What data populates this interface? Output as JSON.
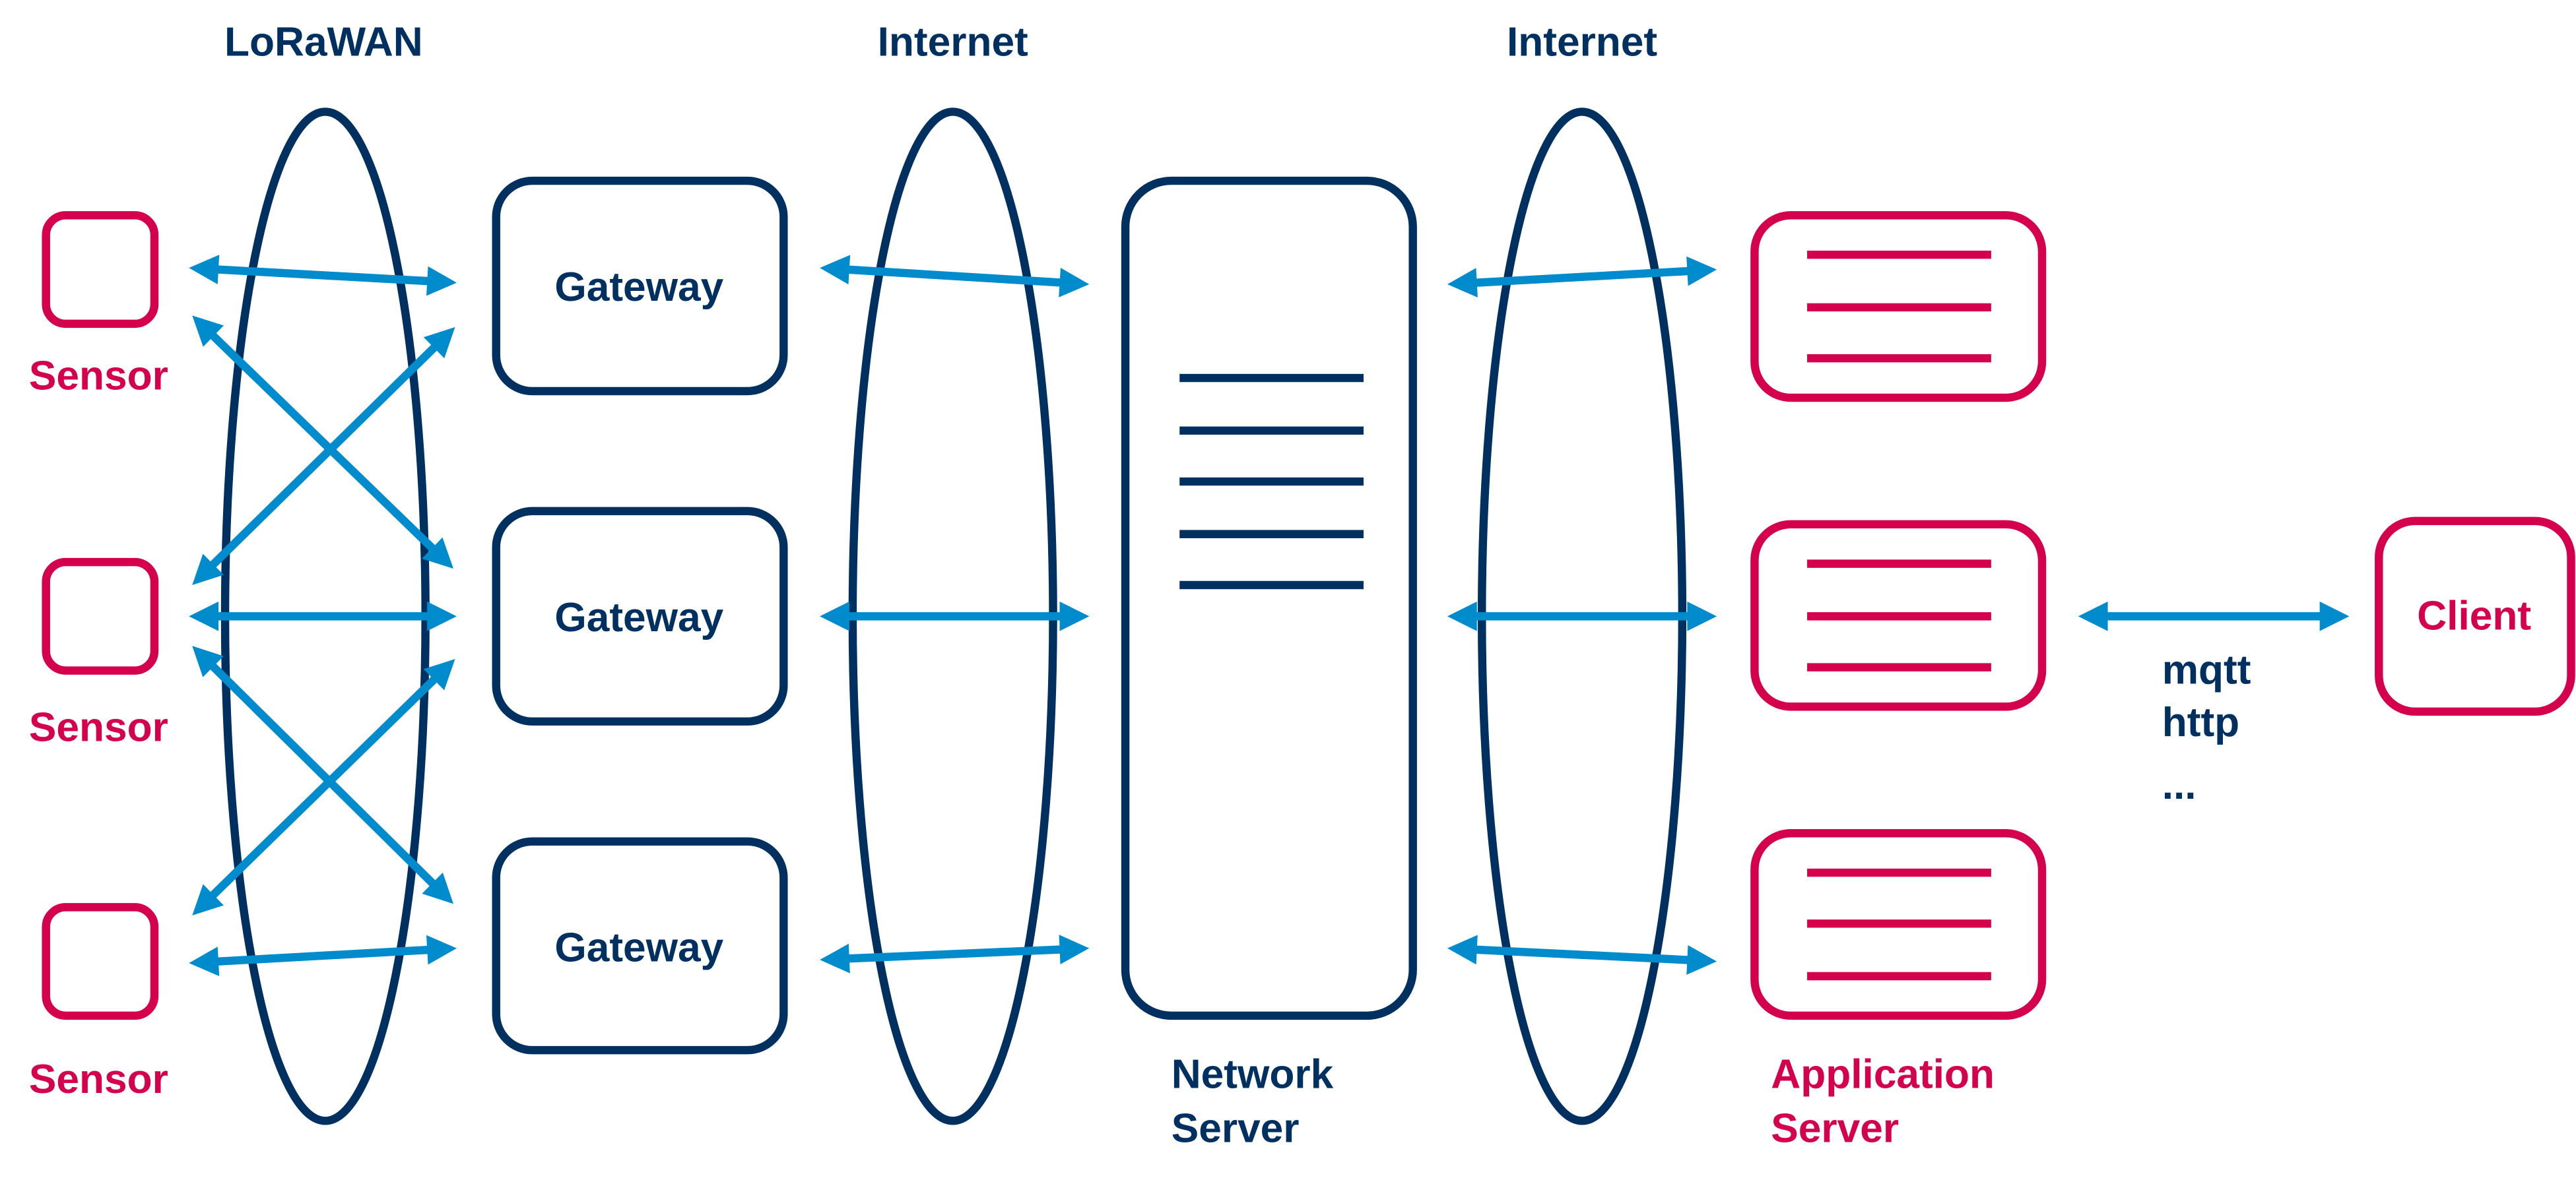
{
  "colors": {
    "navy": "#00305F",
    "crimson": "#D4004B",
    "link_blue": "#008CCC",
    "background": "#FFFFFF"
  },
  "headers": {
    "lorawan": "LoRaWAN",
    "internet_left": "Internet",
    "internet_right": "Internet"
  },
  "sensors": [
    {
      "label": "Sensor"
    },
    {
      "label": "Sensor"
    },
    {
      "label": "Sensor"
    }
  ],
  "gateways": [
    {
      "label": "Gateway"
    },
    {
      "label": "Gateway"
    },
    {
      "label": "Gateway"
    }
  ],
  "network_server": {
    "label_line1": "Network",
    "label_line2": "Server"
  },
  "application_servers": {
    "count": 3,
    "label_line1": "Application",
    "label_line2": "Server"
  },
  "client": {
    "label": "Client"
  },
  "protocols": [
    "mqtt",
    "http",
    "..."
  ],
  "connections": [
    {
      "from": "sensor-1",
      "to": "gateway-1",
      "type": "bidirectional"
    },
    {
      "from": "sensor-1",
      "to": "gateway-2",
      "type": "bidirectional"
    },
    {
      "from": "sensor-2",
      "to": "gateway-1",
      "type": "bidirectional"
    },
    {
      "from": "sensor-2",
      "to": "gateway-2",
      "type": "bidirectional"
    },
    {
      "from": "sensor-2",
      "to": "gateway-3",
      "type": "bidirectional"
    },
    {
      "from": "sensor-3",
      "to": "gateway-2",
      "type": "bidirectional"
    },
    {
      "from": "sensor-3",
      "to": "gateway-3",
      "type": "bidirectional"
    },
    {
      "from": "gateway-1",
      "to": "network-server",
      "type": "bidirectional"
    },
    {
      "from": "gateway-2",
      "to": "network-server",
      "type": "bidirectional"
    },
    {
      "from": "gateway-3",
      "to": "network-server",
      "type": "bidirectional"
    },
    {
      "from": "network-server",
      "to": "application-server-1",
      "type": "bidirectional"
    },
    {
      "from": "network-server",
      "to": "application-server-2",
      "type": "bidirectional"
    },
    {
      "from": "network-server",
      "to": "application-server-3",
      "type": "bidirectional"
    },
    {
      "from": "application-server-2",
      "to": "client",
      "type": "bidirectional"
    }
  ]
}
